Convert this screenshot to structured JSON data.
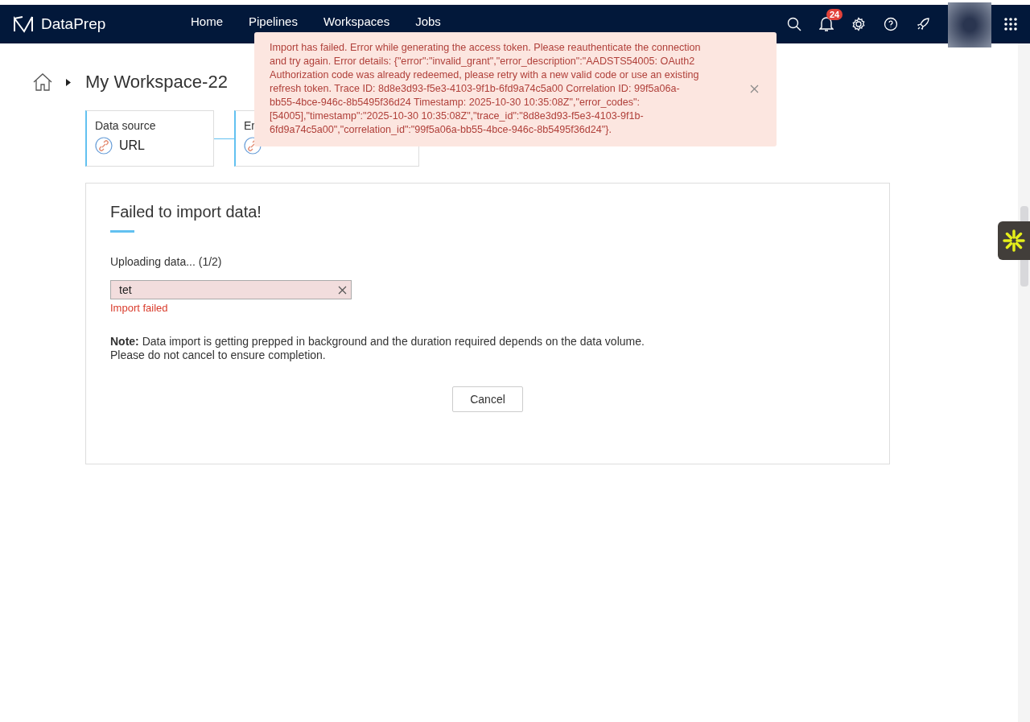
{
  "app": {
    "name": "DataPrep"
  },
  "nav": [
    {
      "label": "Home",
      "selected": false
    },
    {
      "label": "Pipelines",
      "selected": false
    },
    {
      "label": "Workspaces",
      "selected": false
    },
    {
      "label": "Jobs",
      "selected": false
    }
  ],
  "notifications": {
    "count": "24"
  },
  "toast": {
    "message": "Import has failed. Error while generating the access token. Please reauthenticate the connection and try again. Error details: {\"error\":\"invalid_grant\",\"error_description\":\"AADSTS54005: OAuth2 Authorization code was already redeemed, please retry with a new valid code or use an existing refresh token. Trace ID: 8d8e3d93-f5e3-4103-9f1b-6fd9a74c5a00 Correlation ID: 99f5a06a-bb55-4bce-946c-8b5495f36d24 Timestamp: 2025-10-30 10:35:08Z\",\"error_codes\":[54005],\"timestamp\":\"2025-10-30 10:35:08Z\",\"trace_id\":\"8d8e3d93-f5e3-4103-9f1b-6fd9a74c5a00\",\"correlation_id\":\"99f5a06a-bb55-4bce-946c-8b5495f36d24\"}."
  },
  "breadcrumb": {
    "title": "My Workspace-22"
  },
  "steps": [
    {
      "label": "Data source",
      "value": "URL"
    },
    {
      "label": "Er"
    }
  ],
  "panel": {
    "title": "Failed to import data!",
    "progress": "Uploading data... (1/2)",
    "file": {
      "name": "tet",
      "status": "Import failed",
      "failed": true
    },
    "note": "**Note:** Data import is getting prepped in background and the duration required depends on the data volume.",
    "note_2": "Please do not cancel to ensure completion.",
    "button": "Cancel"
  }
}
